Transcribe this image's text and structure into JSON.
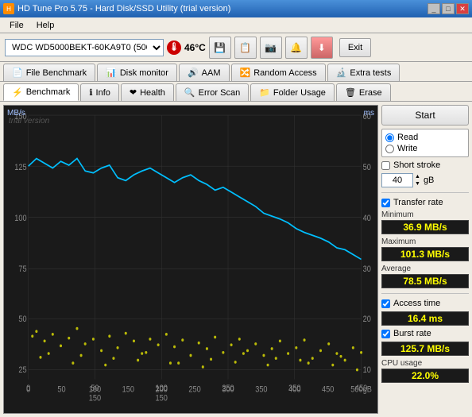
{
  "window": {
    "title": "HD Tune Pro 5.75 - Hard Disk/SSD Utility (trial version)"
  },
  "menu": {
    "file": "File",
    "help": "Help"
  },
  "toolbar": {
    "drive": "WDC WD5000BEKT-60KA9T0 (500 gB)",
    "temperature": "46°C",
    "exit_label": "Exit"
  },
  "tabs_row1": [
    {
      "id": "file-benchmark",
      "label": "File Benchmark",
      "icon": "📄"
    },
    {
      "id": "disk-monitor",
      "label": "Disk monitor",
      "icon": "📊"
    },
    {
      "id": "aam",
      "label": "AAM",
      "icon": "🔊"
    },
    {
      "id": "random-access",
      "label": "Random Access",
      "icon": "🔀"
    },
    {
      "id": "extra-tests",
      "label": "Extra tests",
      "icon": "🔬"
    }
  ],
  "tabs_row2": [
    {
      "id": "benchmark",
      "label": "Benchmark",
      "icon": "⚡",
      "active": true
    },
    {
      "id": "info",
      "label": "Info",
      "icon": "ℹ"
    },
    {
      "id": "health",
      "label": "Health",
      "icon": "❤"
    },
    {
      "id": "error-scan",
      "label": "Error Scan",
      "icon": "🔍"
    },
    {
      "id": "folder-usage",
      "label": "Folder Usage",
      "icon": "📁"
    },
    {
      "id": "erase",
      "label": "Erase",
      "icon": "🗑"
    }
  ],
  "chart": {
    "y_left_label": "MB/s",
    "y_right_label": "ms",
    "y_left_max": 150,
    "y_right_max": 60,
    "watermark": "trial version",
    "x_labels": [
      "0",
      "50",
      "100",
      "150",
      "200",
      "250",
      "300",
      "350",
      "400",
      "450",
      "500gB"
    ]
  },
  "controls": {
    "start_label": "Start",
    "read_label": "Read",
    "write_label": "Write",
    "short_stroke_label": "Short stroke",
    "short_stroke_checked": false,
    "spinbox_value": "40",
    "spinbox_unit": "gB",
    "transfer_rate_label": "Transfer rate",
    "transfer_rate_checked": true,
    "access_time_label": "Access time",
    "access_time_checked": true,
    "burst_rate_label": "Burst rate",
    "burst_rate_checked": true,
    "cpu_usage_label": "CPU usage"
  },
  "stats": {
    "minimum_label": "Minimum",
    "minimum_value": "36.9 MB/s",
    "maximum_label": "Maximum",
    "maximum_value": "101.3 MB/s",
    "average_label": "Average",
    "average_value": "78.5 MB/s",
    "access_time_label": "Access time",
    "access_time_value": "16.4 ms",
    "burst_rate_label": "Burst rate",
    "burst_rate_value": "125.7 MB/s",
    "cpu_usage_label": "CPU usage",
    "cpu_usage_value": "22.0%"
  },
  "colors": {
    "accent": "#316ac5",
    "stat_bg": "#1a1a1a",
    "stat_text": "#ffff00",
    "chart_bg": "#1a1a1a",
    "line_color": "#00bfff",
    "scatter_color": "#ffff00"
  }
}
